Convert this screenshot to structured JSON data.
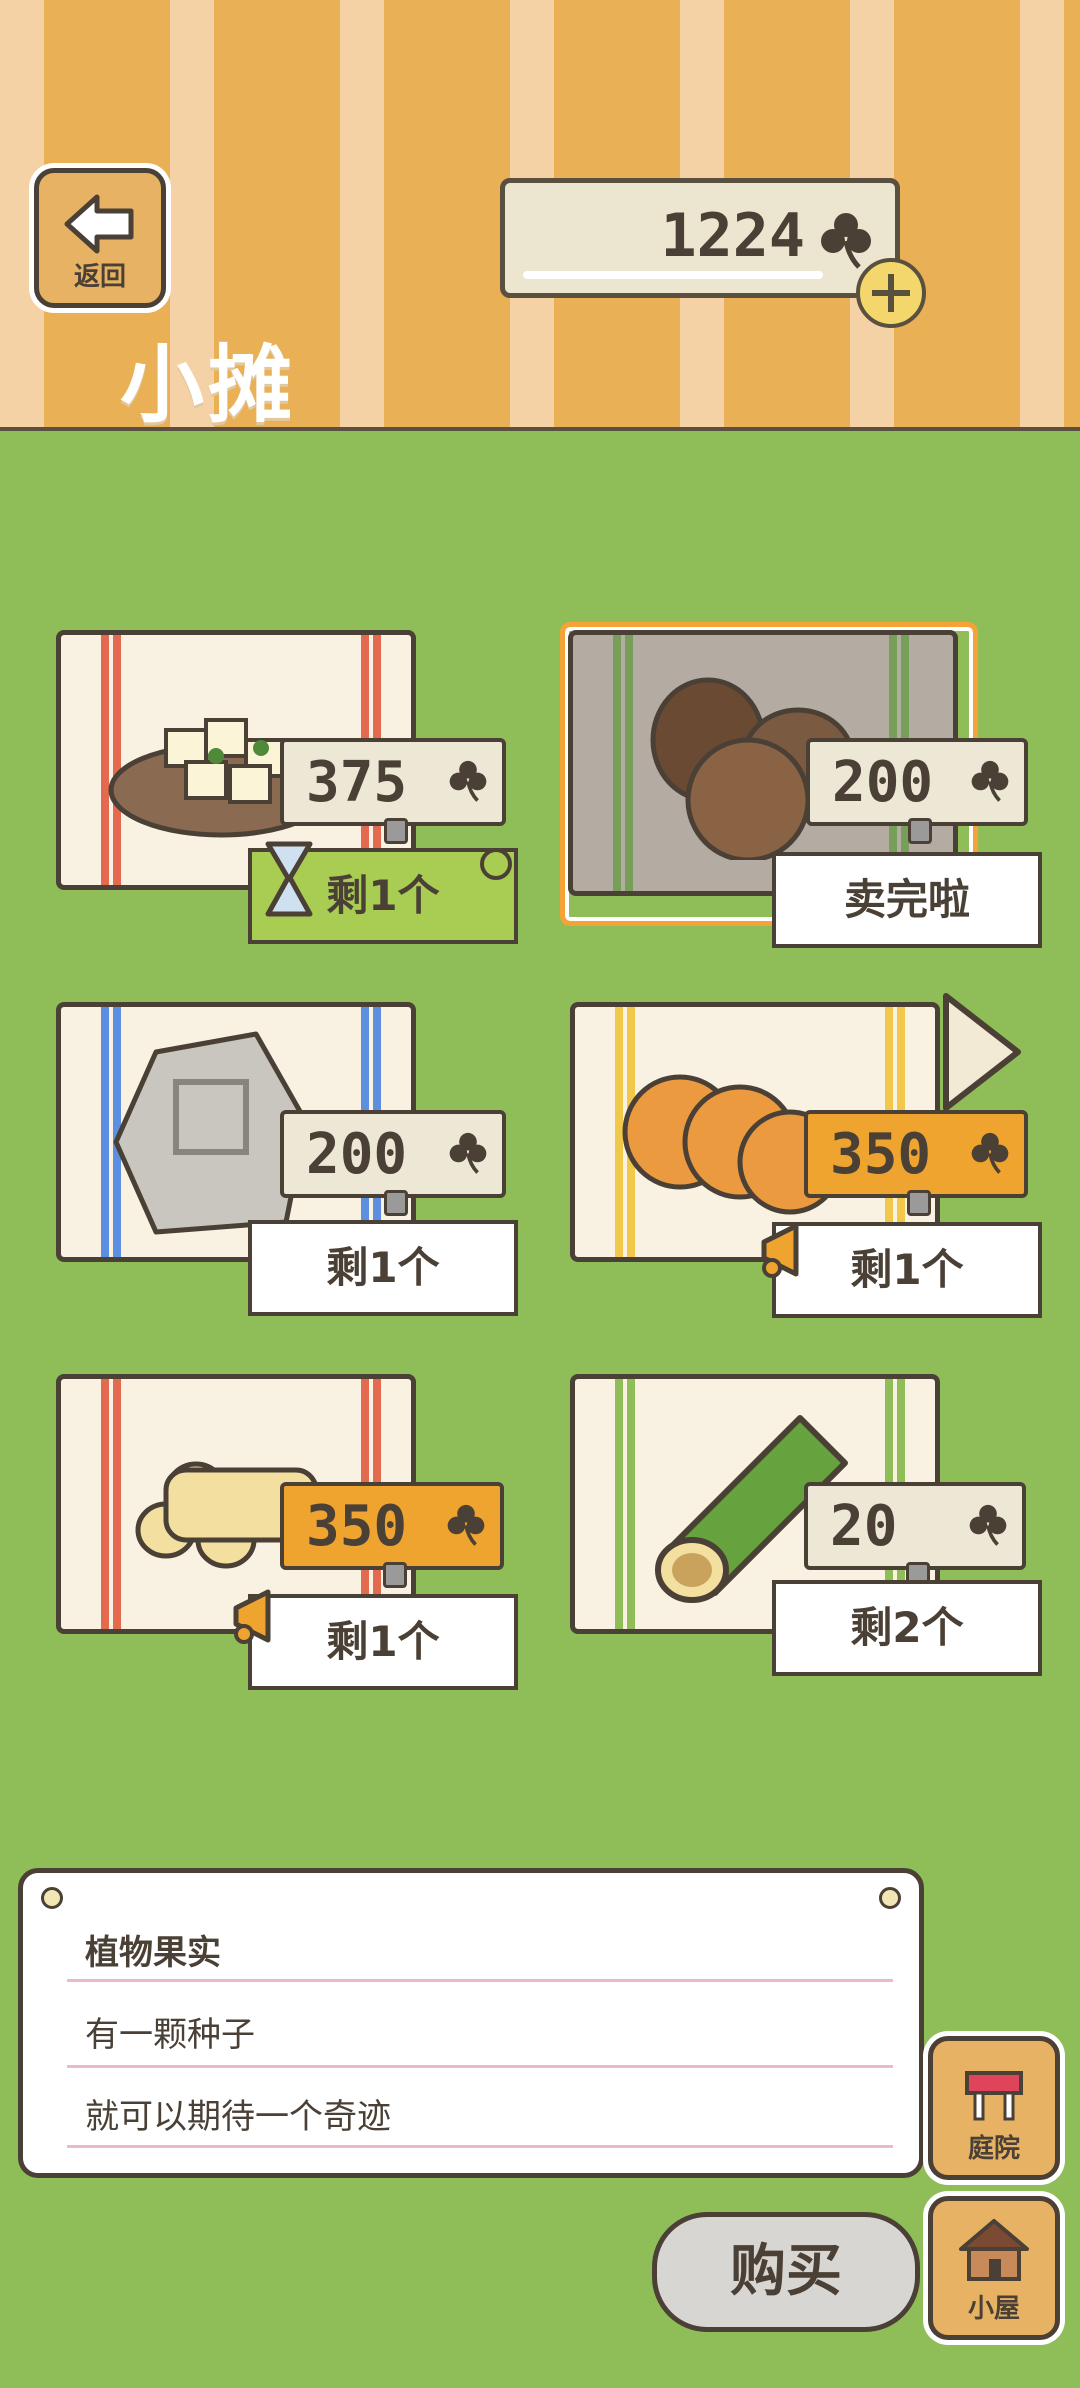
{
  "header": {
    "back_label": "返回",
    "title": "小摊",
    "currency": "1224"
  },
  "items": [
    {
      "name": "tofu",
      "price": "375",
      "stock": "剩1个"
    },
    {
      "name": "chestnut",
      "price": "200",
      "stock": "卖完啦"
    },
    {
      "name": "stone",
      "price": "200",
      "stock": "剩1个"
    },
    {
      "name": "pancake",
      "price": "350",
      "stock": "剩1个"
    },
    {
      "name": "yuba-rolls",
      "price": "350",
      "stock": "剩1个"
    },
    {
      "name": "bamboo",
      "price": "20",
      "stock": "剩2个"
    }
  ],
  "info": {
    "line1": "植物果实",
    "line2": "有一颗种子",
    "line3": "就可以期待一个奇迹"
  },
  "buttons": {
    "buy": "购买",
    "garden": "庭院",
    "house": "小屋"
  },
  "colors": {
    "grass": "#8fbe58",
    "orange_tag": "#eea42e",
    "green_stock": "#a9cc53",
    "selected": "#f5a336"
  }
}
